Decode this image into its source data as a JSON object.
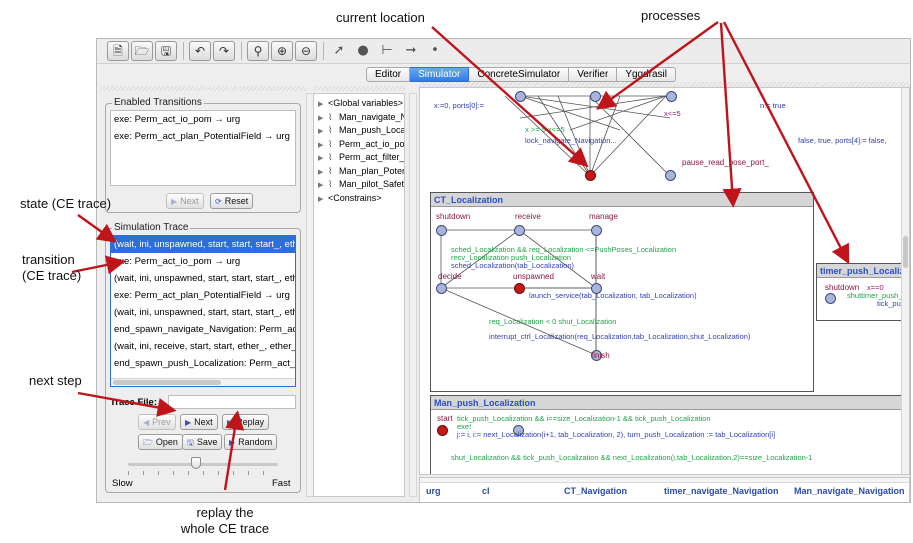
{
  "toolbar": {
    "icons": [
      "new-file-icon",
      "open-file-icon",
      "save-icon",
      "undo-icon",
      "redo-icon",
      "zoom-icon",
      "zoom-in-icon",
      "zoom-out-icon",
      "select-tool-icon",
      "location-tool-icon",
      "branch-tool-icon",
      "edge-tool-icon",
      "nail-tool-icon"
    ]
  },
  "tabs": [
    {
      "label": "Editor",
      "active": false
    },
    {
      "label": "Simulator",
      "active": true
    },
    {
      "label": "ConcreteSimulator",
      "active": false
    },
    {
      "label": "Verifier",
      "active": false
    },
    {
      "label": "Yggdrasil",
      "active": false
    }
  ],
  "enabled": {
    "title": "Enabled Transitions",
    "items": [
      "exe: Perm_act_io_pom → urg",
      "exe: Perm_act_plan_PotentialField → urg"
    ],
    "next_label": "Next",
    "reset_label": "Reset"
  },
  "trace": {
    "title": "Simulation Trace",
    "items": [
      "(wait, ini, unspawned, start, start, start_, eth",
      "exe: Perm_act_io_pom → urg",
      "(wait, ini, unspawned, start, start, start_, eth",
      "exe: Perm_act_plan_PotentialField → urg",
      "(wait, ini, unspawned, start, start, start_, eth",
      "end_spawn_navigate_Navigation: Perm_act_r",
      "(wait, ini, receive, start, start, ether_, ether_",
      "end_spawn_push_Localization: Perm_act_pu"
    ],
    "selected_index": 0,
    "file_label": "Trace File:",
    "file_value": "",
    "prev_label": "Prev",
    "next_label": "Next",
    "replay_label": "Replay",
    "open_label": "Open",
    "save_label": "Save",
    "random_label": "Random",
    "slow_label": "Slow",
    "fast_label": "Fast",
    "speed": 0.45
  },
  "tree": {
    "items": [
      "<Global variables>",
      "Man_navigate_Nav",
      "Man_push_Localiza",
      "Perm_act_io_pom",
      "Perm_act_filter_po",
      "Man_plan_Potentia",
      "Man_pilot_SafetyPi",
      "<Constrains>"
    ]
  },
  "canvas": {
    "top_labels": {
      "x_reset": "x:=0, ports[0]:=",
      "x_guard": "x<=5",
      "x_guard_pair": "x >= 5   x<=5",
      "lock_text": "lock_navigate_Navigation...",
      "tail_text": "false, true, ports[4]:= false,",
      "true_text": "n:= true",
      "pause": "pause_read_pose_port_"
    },
    "ct_localization": {
      "title": "CT_Localization",
      "locations": [
        "shutdown",
        "receive",
        "manage",
        "decide",
        "unspawned",
        "wait",
        "finish"
      ],
      "g1": "sched_Localization && req_Localization <=PushPoses_Localization",
      "g2": "recv_Localization push_Localization",
      "g3": "sched_Localization(tab_Localization)",
      "g4": "launch_service(tab_Localization, tab_Localization)",
      "g5": "req_Localization < 0   shut_Localization",
      "g6": "interrupt_ctrl_Localization(req_Localization,tab_Localization,shut_Localization)"
    },
    "timer": {
      "title": "timer_push_Localiza",
      "loc": "shutdown",
      "guard": "x==0",
      "sync": "shuttimer_push_L",
      "tick": "tick_pu"
    },
    "man_push": {
      "title": "Man_push_Localization",
      "start": "start",
      "g1": "tick_push_Localization && i==size_Localization-1 && tick_push_Localization",
      "g2": "j:= i, i:= next_Localization(i+1, tab_Localization, 2), turn_push_Localization := tab_Localization[i]",
      "g3": "shut_Localization && tick_push_Localization && next_Localization(i,tab_Localization,2)==size_Localization-1",
      "g4": "exe!"
    }
  },
  "variables": [
    "urg",
    "cl",
    "CT_Navigation",
    "timer_navigate_Navigation",
    "Man_navigate_Navigation"
  ],
  "annotations": {
    "current_location": "current location",
    "processes": "processes",
    "state": "state (CE trace)",
    "transition_line1": "transition",
    "transition_line2": "(CE trace)",
    "next_step": "next step",
    "replay_line1": "replay the",
    "replay_line2": "whole CE trace"
  },
  "colors": {
    "accent": "#2d6ed8",
    "urgent_location": "#c51818",
    "arrow": "#c0141b",
    "guard": "#22a24a",
    "update": "#3341b5"
  }
}
